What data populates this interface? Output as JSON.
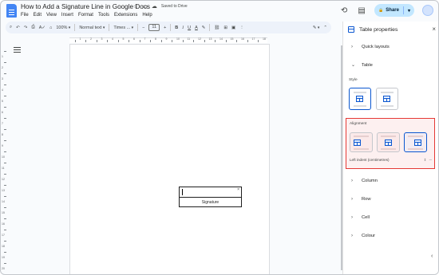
{
  "doc": {
    "title": "How to Add a Signature Line in Google Docs",
    "star_icon": "☆",
    "folder_icon": "▭",
    "cloud_icon": "☁",
    "saved_text": "Saved to Drive"
  },
  "menu": [
    "File",
    "Edit",
    "View",
    "Insert",
    "Format",
    "Tools",
    "Extensions",
    "Help"
  ],
  "topbar": {
    "history_icon": "⟲",
    "comment_icon": "▤",
    "share_label": "Share",
    "share_lock_icon": "🔒",
    "share_caret": "▾"
  },
  "toolbar": {
    "search_icon": "⌕",
    "undo_icon": "↶",
    "redo_icon": "↷",
    "print_icon": "⎙",
    "spell_icon": "A✓",
    "paint_icon": "⌂",
    "zoom": "100%",
    "style": "Normal text",
    "font": "Times ...",
    "minus": "−",
    "font_size": "11",
    "plus": "+",
    "bold": "B",
    "italic": "I",
    "underline": "U",
    "text_color": "A",
    "highlight": "✎",
    "link": "⛓",
    "comment": "⊞",
    "image": "▣",
    "more": "⋮",
    "edit_mode": "✎",
    "collapse": "⌃"
  },
  "table": {
    "signature_label": "Signature",
    "close_icon": "×"
  },
  "panel": {
    "title": "Table properties",
    "close_icon": "×",
    "quick_layouts": "Quick layouts",
    "table": "Table",
    "style_label": "Style",
    "alignment_label": "Alignment",
    "left_indent_label": "Left indent (centimetres)",
    "left_indent_value": "⇕ ─",
    "column": "Column",
    "row": "Row",
    "cell": "Cell",
    "colour": "Colour",
    "chev_right": "›",
    "chev_down": "⌄",
    "side_chevron": "‹"
  },
  "ruler": {
    "h_numbers": [
      "1",
      "2",
      "3",
      "4",
      "5",
      "6",
      "7",
      "8",
      "9",
      "10",
      "11",
      "12",
      "13",
      "14",
      "15",
      "16",
      "17",
      "18"
    ],
    "v_numbers": [
      "1",
      "2",
      "3",
      "4",
      "5",
      "6",
      "7",
      "8",
      "9",
      "10",
      "11",
      "12",
      "13",
      "14",
      "15",
      "16",
      "17",
      "18",
      "19",
      "20"
    ]
  },
  "colors": {
    "accent": "#0b57d0",
    "share_bg": "#c2e7ff",
    "highlight_border": "#e53935",
    "toolbar_bg": "#edf2fa"
  }
}
